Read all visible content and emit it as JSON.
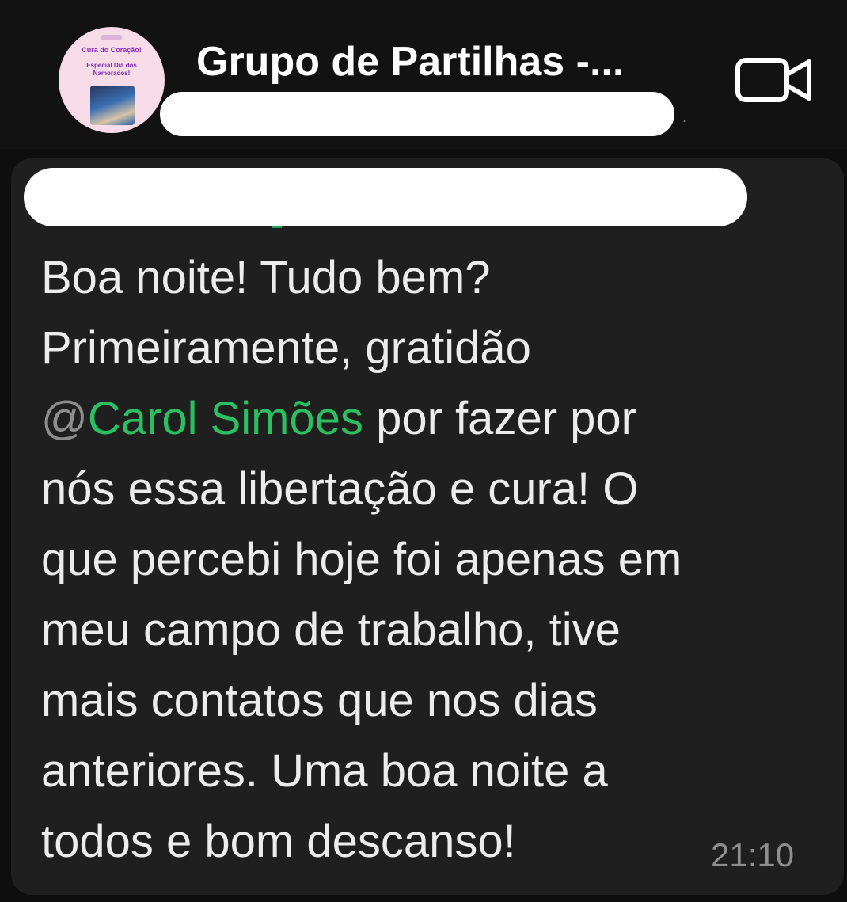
{
  "header": {
    "title": "Grupo de Partilhas -...",
    "avatar_line1": "Cura do Coração!",
    "avatar_line2": "Especial Dia dos Namorados!",
    "video_icon": "video-camera-icon"
  },
  "message": {
    "line1": "Boa noite! Tudo bem?",
    "line2": "Primeiramente, gratidão",
    "mention_at": "@",
    "mention_name": "Carol Simões",
    "line3_rest": " por fazer por",
    "line4": "nós essa libertação e cura! O",
    "line5": "que percebi hoje foi apenas em",
    "line6": "meu campo de trabalho, tive",
    "line7": "mais contatos que nos dias",
    "line8": "anteriores. Uma boa noite a",
    "line9": "todos e bom descanso!",
    "time": "21:10"
  },
  "colors": {
    "mention": "#2bbf62",
    "bubble": "#1f1f1f",
    "header": "#121212"
  }
}
